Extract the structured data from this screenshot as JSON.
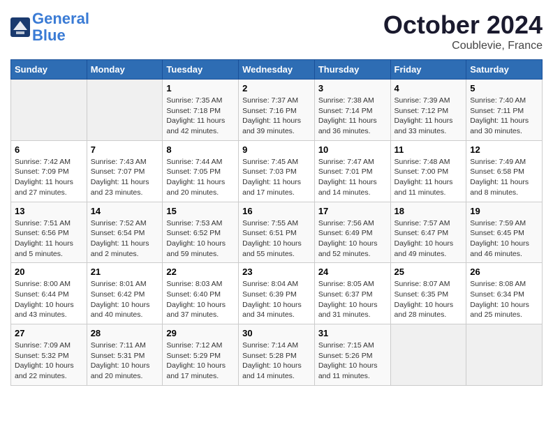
{
  "header": {
    "logo_line1": "General",
    "logo_line2": "Blue",
    "month": "October 2024",
    "location": "Coublevie, France"
  },
  "days_of_week": [
    "Sunday",
    "Monday",
    "Tuesday",
    "Wednesday",
    "Thursday",
    "Friday",
    "Saturday"
  ],
  "weeks": [
    [
      {
        "day": "",
        "sunrise": "",
        "sunset": "",
        "daylight": ""
      },
      {
        "day": "",
        "sunrise": "",
        "sunset": "",
        "daylight": ""
      },
      {
        "day": "1",
        "sunrise": "Sunrise: 7:35 AM",
        "sunset": "Sunset: 7:18 PM",
        "daylight": "Daylight: 11 hours and 42 minutes."
      },
      {
        "day": "2",
        "sunrise": "Sunrise: 7:37 AM",
        "sunset": "Sunset: 7:16 PM",
        "daylight": "Daylight: 11 hours and 39 minutes."
      },
      {
        "day": "3",
        "sunrise": "Sunrise: 7:38 AM",
        "sunset": "Sunset: 7:14 PM",
        "daylight": "Daylight: 11 hours and 36 minutes."
      },
      {
        "day": "4",
        "sunrise": "Sunrise: 7:39 AM",
        "sunset": "Sunset: 7:12 PM",
        "daylight": "Daylight: 11 hours and 33 minutes."
      },
      {
        "day": "5",
        "sunrise": "Sunrise: 7:40 AM",
        "sunset": "Sunset: 7:11 PM",
        "daylight": "Daylight: 11 hours and 30 minutes."
      }
    ],
    [
      {
        "day": "6",
        "sunrise": "Sunrise: 7:42 AM",
        "sunset": "Sunset: 7:09 PM",
        "daylight": "Daylight: 11 hours and 27 minutes."
      },
      {
        "day": "7",
        "sunrise": "Sunrise: 7:43 AM",
        "sunset": "Sunset: 7:07 PM",
        "daylight": "Daylight: 11 hours and 23 minutes."
      },
      {
        "day": "8",
        "sunrise": "Sunrise: 7:44 AM",
        "sunset": "Sunset: 7:05 PM",
        "daylight": "Daylight: 11 hours and 20 minutes."
      },
      {
        "day": "9",
        "sunrise": "Sunrise: 7:45 AM",
        "sunset": "Sunset: 7:03 PM",
        "daylight": "Daylight: 11 hours and 17 minutes."
      },
      {
        "day": "10",
        "sunrise": "Sunrise: 7:47 AM",
        "sunset": "Sunset: 7:01 PM",
        "daylight": "Daylight: 11 hours and 14 minutes."
      },
      {
        "day": "11",
        "sunrise": "Sunrise: 7:48 AM",
        "sunset": "Sunset: 7:00 PM",
        "daylight": "Daylight: 11 hours and 11 minutes."
      },
      {
        "day": "12",
        "sunrise": "Sunrise: 7:49 AM",
        "sunset": "Sunset: 6:58 PM",
        "daylight": "Daylight: 11 hours and 8 minutes."
      }
    ],
    [
      {
        "day": "13",
        "sunrise": "Sunrise: 7:51 AM",
        "sunset": "Sunset: 6:56 PM",
        "daylight": "Daylight: 11 hours and 5 minutes."
      },
      {
        "day": "14",
        "sunrise": "Sunrise: 7:52 AM",
        "sunset": "Sunset: 6:54 PM",
        "daylight": "Daylight: 11 hours and 2 minutes."
      },
      {
        "day": "15",
        "sunrise": "Sunrise: 7:53 AM",
        "sunset": "Sunset: 6:52 PM",
        "daylight": "Daylight: 10 hours and 59 minutes."
      },
      {
        "day": "16",
        "sunrise": "Sunrise: 7:55 AM",
        "sunset": "Sunset: 6:51 PM",
        "daylight": "Daylight: 10 hours and 55 minutes."
      },
      {
        "day": "17",
        "sunrise": "Sunrise: 7:56 AM",
        "sunset": "Sunset: 6:49 PM",
        "daylight": "Daylight: 10 hours and 52 minutes."
      },
      {
        "day": "18",
        "sunrise": "Sunrise: 7:57 AM",
        "sunset": "Sunset: 6:47 PM",
        "daylight": "Daylight: 10 hours and 49 minutes."
      },
      {
        "day": "19",
        "sunrise": "Sunrise: 7:59 AM",
        "sunset": "Sunset: 6:45 PM",
        "daylight": "Daylight: 10 hours and 46 minutes."
      }
    ],
    [
      {
        "day": "20",
        "sunrise": "Sunrise: 8:00 AM",
        "sunset": "Sunset: 6:44 PM",
        "daylight": "Daylight: 10 hours and 43 minutes."
      },
      {
        "day": "21",
        "sunrise": "Sunrise: 8:01 AM",
        "sunset": "Sunset: 6:42 PM",
        "daylight": "Daylight: 10 hours and 40 minutes."
      },
      {
        "day": "22",
        "sunrise": "Sunrise: 8:03 AM",
        "sunset": "Sunset: 6:40 PM",
        "daylight": "Daylight: 10 hours and 37 minutes."
      },
      {
        "day": "23",
        "sunrise": "Sunrise: 8:04 AM",
        "sunset": "Sunset: 6:39 PM",
        "daylight": "Daylight: 10 hours and 34 minutes."
      },
      {
        "day": "24",
        "sunrise": "Sunrise: 8:05 AM",
        "sunset": "Sunset: 6:37 PM",
        "daylight": "Daylight: 10 hours and 31 minutes."
      },
      {
        "day": "25",
        "sunrise": "Sunrise: 8:07 AM",
        "sunset": "Sunset: 6:35 PM",
        "daylight": "Daylight: 10 hours and 28 minutes."
      },
      {
        "day": "26",
        "sunrise": "Sunrise: 8:08 AM",
        "sunset": "Sunset: 6:34 PM",
        "daylight": "Daylight: 10 hours and 25 minutes."
      }
    ],
    [
      {
        "day": "27",
        "sunrise": "Sunrise: 7:09 AM",
        "sunset": "Sunset: 5:32 PM",
        "daylight": "Daylight: 10 hours and 22 minutes."
      },
      {
        "day": "28",
        "sunrise": "Sunrise: 7:11 AM",
        "sunset": "Sunset: 5:31 PM",
        "daylight": "Daylight: 10 hours and 20 minutes."
      },
      {
        "day": "29",
        "sunrise": "Sunrise: 7:12 AM",
        "sunset": "Sunset: 5:29 PM",
        "daylight": "Daylight: 10 hours and 17 minutes."
      },
      {
        "day": "30",
        "sunrise": "Sunrise: 7:14 AM",
        "sunset": "Sunset: 5:28 PM",
        "daylight": "Daylight: 10 hours and 14 minutes."
      },
      {
        "day": "31",
        "sunrise": "Sunrise: 7:15 AM",
        "sunset": "Sunset: 5:26 PM",
        "daylight": "Daylight: 10 hours and 11 minutes."
      },
      {
        "day": "",
        "sunrise": "",
        "sunset": "",
        "daylight": ""
      },
      {
        "day": "",
        "sunrise": "",
        "sunset": "",
        "daylight": ""
      }
    ]
  ]
}
